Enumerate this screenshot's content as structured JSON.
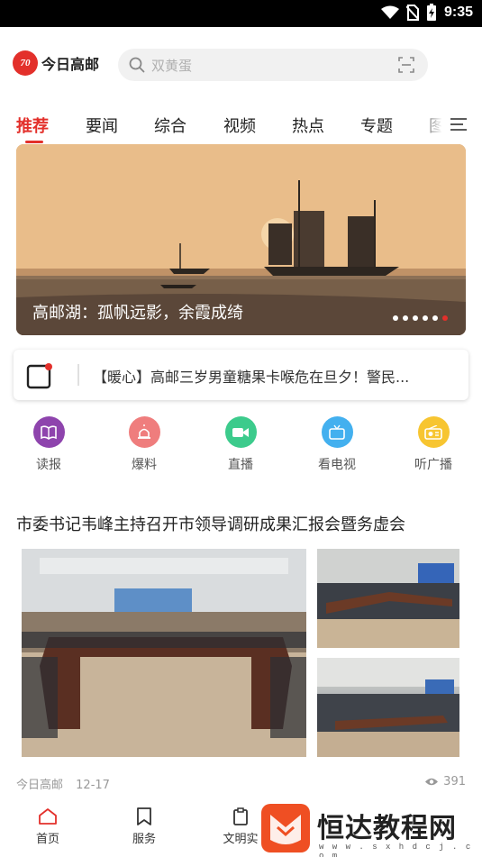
{
  "status_bar": {
    "time": "9:35",
    "icons": [
      "wifi-icon",
      "no-sim-icon",
      "battery-charging-icon"
    ]
  },
  "header": {
    "logo_text": "今日高邮",
    "search": {
      "placeholder": "双黄蛋",
      "icons": [
        "search-icon",
        "scan-icon"
      ]
    }
  },
  "tabs": [
    {
      "label": "推荐",
      "active": true
    },
    {
      "label": "要闻",
      "active": false
    },
    {
      "label": "综合",
      "active": false
    },
    {
      "label": "视频",
      "active": false
    },
    {
      "label": "热点",
      "active": false
    },
    {
      "label": "专题",
      "active": false
    },
    {
      "label": "图",
      "active": false
    }
  ],
  "banner": {
    "caption": "高邮湖：孤帆远影，余霞成绮",
    "slide_count": 6,
    "active_slide": 6
  },
  "notice": {
    "text": "【暖心】高邮三岁男童糖果卡喉危在旦夕！警民..."
  },
  "quick_entries": [
    {
      "label": "读报",
      "icon": "book-icon",
      "color": "#8e44ad"
    },
    {
      "label": "爆料",
      "icon": "siren-icon",
      "color": "#ef7d7d"
    },
    {
      "label": "直播",
      "icon": "video-camera-icon",
      "color": "#3ccb8c"
    },
    {
      "label": "看电视",
      "icon": "tv-icon",
      "color": "#43b0ef"
    },
    {
      "label": "听广播",
      "icon": "radio-icon",
      "color": "#f7c531"
    }
  ],
  "article": {
    "title": "市委书记韦峰主持召开市领导调研成果汇报会暨务虚会",
    "source": "今日高邮",
    "date": "12-17",
    "views": "391"
  },
  "bottom_nav": [
    {
      "label": "首页",
      "icon": "home-icon",
      "active": true,
      "color": "#e3302b"
    },
    {
      "label": "服务",
      "icon": "bookmark-icon",
      "active": false
    },
    {
      "label": "文明实",
      "icon": "clipboard-icon",
      "active": false
    }
  ],
  "watermark": {
    "text": "恒达教程网",
    "url": "w w w . s x h d c j . c o m"
  },
  "colors": {
    "accent": "#e3302b"
  }
}
